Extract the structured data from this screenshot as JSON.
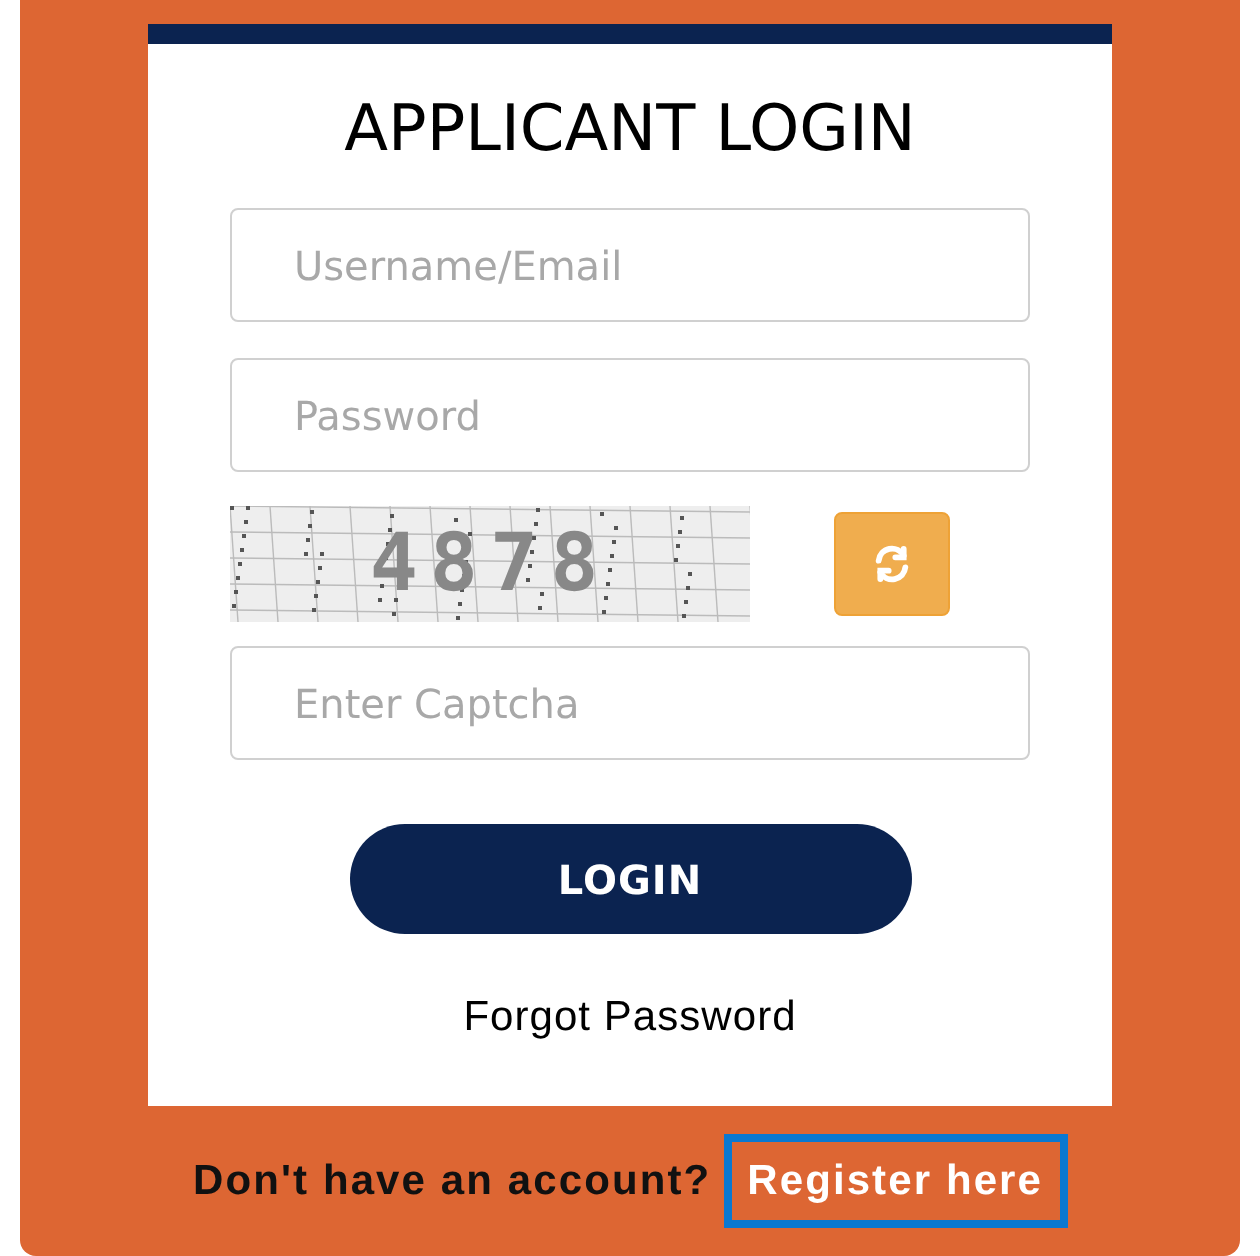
{
  "title": "APPLICANT LOGIN",
  "fields": [
    {
      "placeholder": "Username/Email"
    },
    {
      "placeholder": "Password"
    }
  ],
  "captcha": {
    "code": "4878",
    "placeholder": "Enter Captcha"
  },
  "login_button": "LOGIN",
  "forgot_link": "Forgot Password",
  "footer": {
    "prompt": "Don't have an account?",
    "link": "Register here",
    "highlighted": true
  }
}
